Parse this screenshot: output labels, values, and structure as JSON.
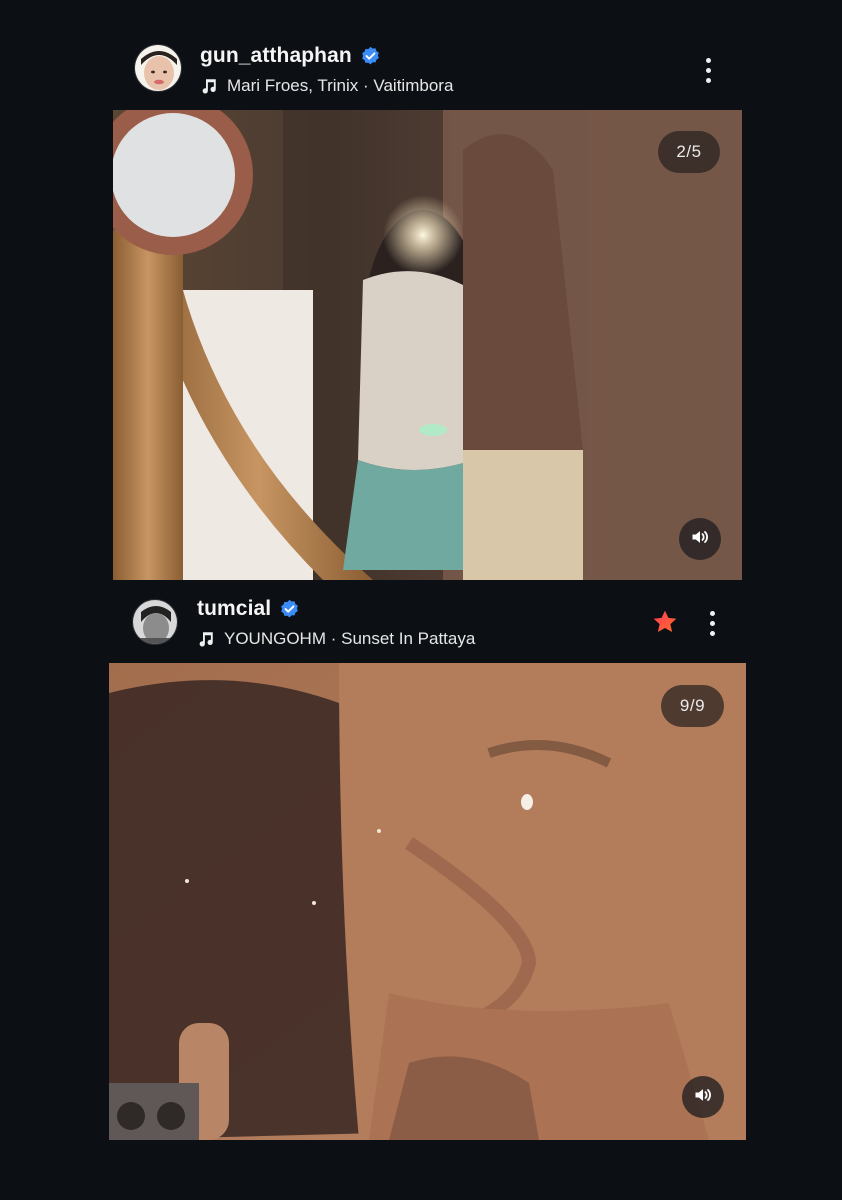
{
  "posts": [
    {
      "username": "gun_atthaphan",
      "verified": true,
      "music": "Mari Froes, Trinix · Vaitimbora",
      "counter": "2/5",
      "starred": false
    },
    {
      "username": "tumcial",
      "verified": true,
      "music": "YOUNGOHM · Sunset In Pattaya",
      "counter": "9/9",
      "starred": true
    }
  ],
  "colors": {
    "background": "#0c1015",
    "verified_blue": "#3b8cf6",
    "star_red": "#f0283c",
    "star_gradient_end": "#ff7a2a"
  },
  "icons": {
    "verified": "verified-badge-icon",
    "music": "music-note-icon",
    "more": "more-vertical-icon",
    "sound": "speaker-icon",
    "favorite": "star-icon"
  }
}
